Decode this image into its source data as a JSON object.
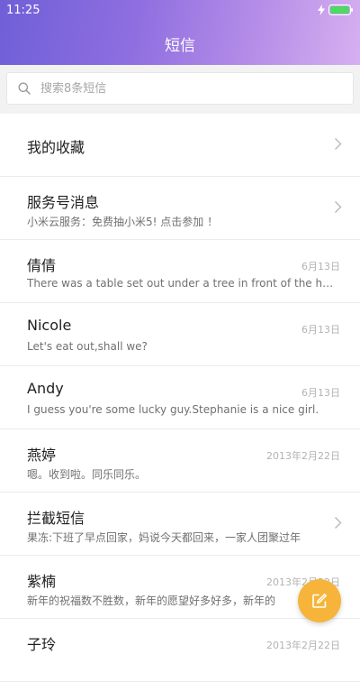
{
  "status_bar": {
    "time": "11:25",
    "battery_color": "#4cd964",
    "charging_icon": "lightning-icon"
  },
  "header": {
    "title": "短信"
  },
  "search": {
    "placeholder": "搜索8条短信",
    "icon": "search-icon"
  },
  "items": [
    {
      "name": "我的收藏",
      "preview": "",
      "date": "",
      "chevron": true
    },
    {
      "name": "服务号消息",
      "preview": "小米云服务：免费抽小米5! 点击参加 ！",
      "date": "",
      "chevron": true
    },
    {
      "name": "倩倩",
      "preview": "There was a table set out under a tree in front of the house",
      "date": "6月13日",
      "chevron": false
    },
    {
      "name": "Nicole",
      "preview": "Let's eat out,shall we?",
      "date": "6月13日",
      "chevron": false
    },
    {
      "name": "Andy",
      "preview": "I guess you're some lucky guy.Stephanie is a nice girl.",
      "date": "6月13日",
      "chevron": false
    },
    {
      "name": "燕婷",
      "preview": "嗯。收到啦。同乐同乐。",
      "date": "2013年2月22日",
      "chevron": false
    },
    {
      "name": "拦截短信",
      "preview": "果冻:下班了早点回家，妈说今天都回来，一家人团聚过年",
      "date": "",
      "chevron": true
    },
    {
      "name": "紫楠",
      "preview": "新年的祝福数不胜数，新年的愿望好多好多，新年的",
      "date": "2013年2月22日",
      "chevron": false
    },
    {
      "name": "子玲",
      "preview": "",
      "date": "2013年2月22日",
      "chevron": false
    }
  ],
  "fab": {
    "icon": "compose-icon",
    "color": "#f6b53a"
  }
}
